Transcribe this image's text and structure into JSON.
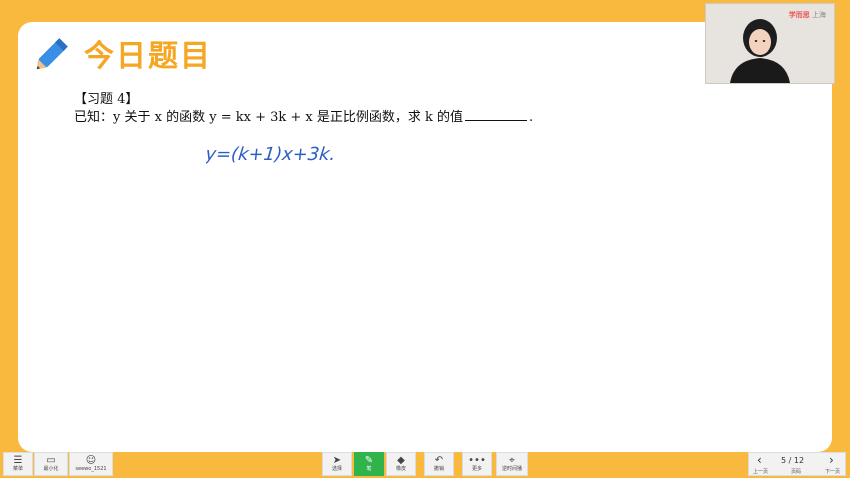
{
  "header": {
    "title": "今日题目"
  },
  "exercise": {
    "title": "【习题 4】",
    "question_prefix": "已知：",
    "question_body": "y 关于 x 的函数 y = kx + 3k + x 是正比例函数，求 k 的值",
    "question_end": "."
  },
  "handwriting": {
    "text": "y=(k+1)x+3k."
  },
  "webcam": {
    "brand": "学而思",
    "city": "上海"
  },
  "toolbar_left": [
    {
      "icon": "☰",
      "label": "菜单"
    },
    {
      "icon": "▭",
      "label": "最小化"
    },
    {
      "icon": "☺",
      "label": "seewo_1521"
    }
  ],
  "toolbar_center": [
    {
      "icon": "➤",
      "label": "选择"
    },
    {
      "icon": "✎",
      "label": "笔"
    },
    {
      "icon": "◆",
      "label": "橡皮"
    },
    {
      "icon": "↶",
      "label": "撤销"
    },
    {
      "icon": "•••",
      "label": "更多"
    },
    {
      "icon": "⌖",
      "label": "逆时间播"
    }
  ],
  "pager": {
    "page": "5 / 12",
    "prev_label": "上一页",
    "mid_label": "页码",
    "next_label": "下一页"
  }
}
